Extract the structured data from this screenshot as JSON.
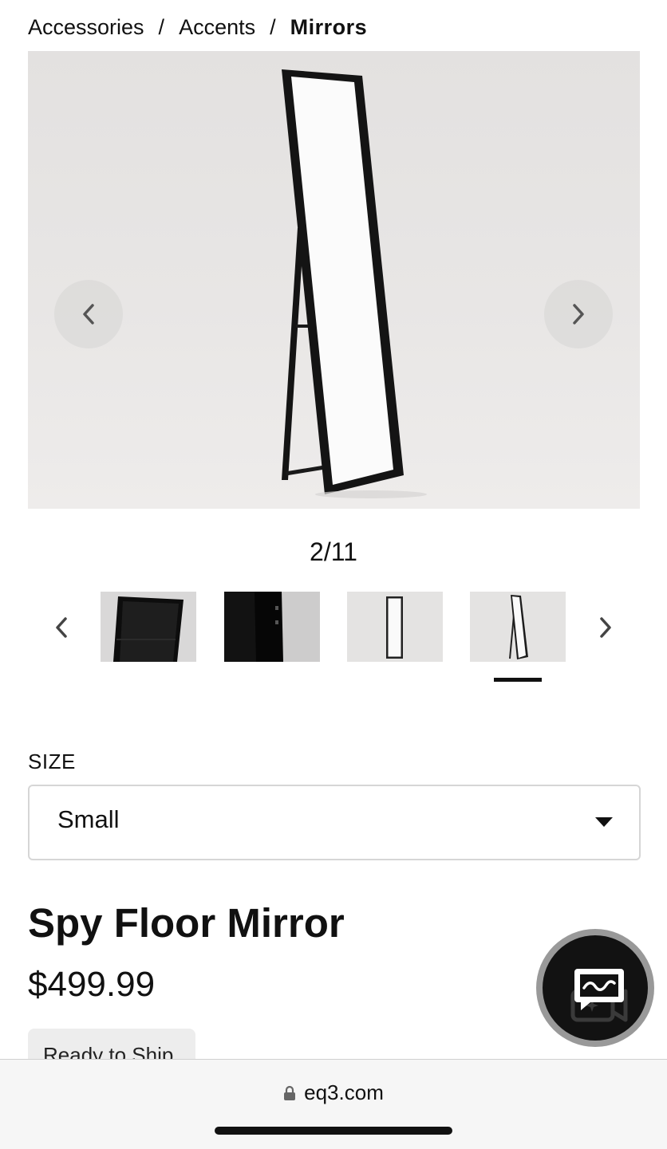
{
  "breadcrumb": {
    "items": [
      "Accessories",
      "Accents"
    ],
    "current": "Mirrors",
    "separator": "/"
  },
  "gallery": {
    "counter": "2/11",
    "prev_icon": "chevron-left-icon",
    "next_icon": "chevron-right-icon",
    "active_thumbnail_index": 3
  },
  "size": {
    "label": "SIZE",
    "selected": "Small"
  },
  "product": {
    "title": "Spy Floor Mirror",
    "price": "$499.99",
    "badge": "Ready to Ship"
  },
  "chat": {
    "icon": "chat-video-icon"
  },
  "browser": {
    "url": "eq3.com"
  }
}
